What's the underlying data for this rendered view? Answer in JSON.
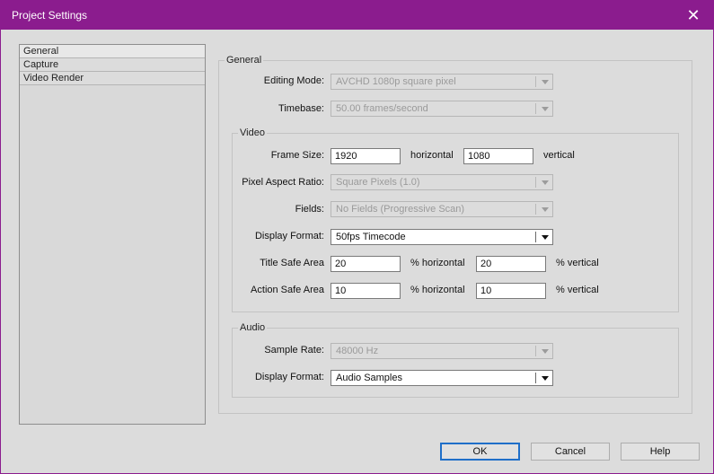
{
  "window": {
    "title": "Project Settings"
  },
  "nav": {
    "items": [
      "General",
      "Capture",
      "Video Render"
    ]
  },
  "general": {
    "title": "General",
    "editing_mode": {
      "label": "Editing Mode:",
      "value": "AVCHD 1080p square pixel"
    },
    "timebase": {
      "label": "Timebase:",
      "value": "50.00 frames/second"
    }
  },
  "video": {
    "title": "Video",
    "frame_size": {
      "label": "Frame Size:",
      "horizontal": "1920",
      "horizontal_unit": "horizontal",
      "vertical": "1080",
      "vertical_unit": "vertical"
    },
    "pixel_aspect": {
      "label": "Pixel Aspect Ratio:",
      "value": "Square Pixels (1.0)"
    },
    "fields": {
      "label": "Fields:",
      "value": "No Fields (Progressive Scan)"
    },
    "display_format": {
      "label": "Display Format:",
      "value": "50fps Timecode"
    },
    "title_safe": {
      "label": "Title Safe Area",
      "horizontal": "20",
      "horizontal_unit": "% horizontal",
      "vertical": "20",
      "vertical_unit": "% vertical"
    },
    "action_safe": {
      "label": "Action Safe Area",
      "horizontal": "10",
      "horizontal_unit": "% horizontal",
      "vertical": "10",
      "vertical_unit": "% vertical"
    }
  },
  "audio": {
    "title": "Audio",
    "sample_rate": {
      "label": "Sample Rate:",
      "value": "48000 Hz"
    },
    "display_format": {
      "label": "Display Format:",
      "value": "Audio Samples"
    }
  },
  "buttons": {
    "ok": "OK",
    "cancel": "Cancel",
    "help": "Help"
  },
  "colors": {
    "titlebar": "#8b1c8e",
    "window_bg": "#dcdcdc",
    "default_button_border": "#1f6fc9"
  }
}
